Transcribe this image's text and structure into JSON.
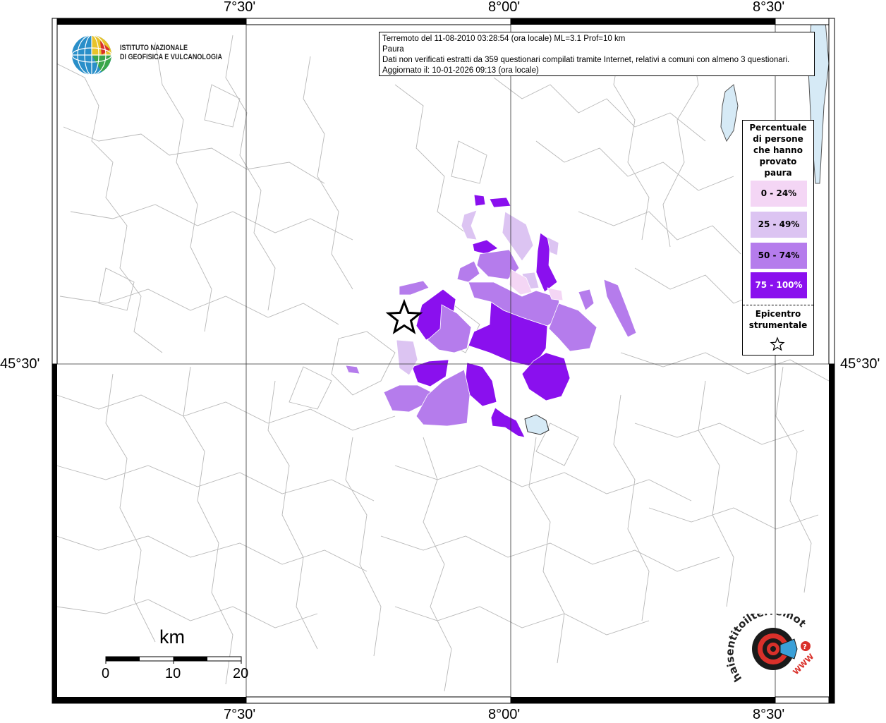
{
  "map": {
    "grid_labels": {
      "lon": [
        "7°30'",
        "8°00'",
        "8°30'"
      ],
      "lat": [
        "45°30'"
      ]
    },
    "colors": {
      "class_0_24": "#f4d6f5",
      "class_25_49": "#dcc4f2",
      "class_50_74": "#b57cec",
      "class_75_100": "#8a10ee",
      "lake": "#d6eaf6",
      "boundaries": "#b8b8b8"
    }
  },
  "info": {
    "line1": "Terremoto del 11-08-2010 03:28:54 (ora locale) ML=3.1 Prof=10 km",
    "line2": "Paura",
    "line3": "Dati non verificati estratti da 359 questionari compilati tramite Internet, relativi a comuni con almeno 3 questionari.",
    "line4": "Aggiornato il: 10-01-2026 09:13 (ora locale)"
  },
  "logo_ingv": {
    "line1": "ISTITUTO NAZIONALE",
    "line2": "DI GEOFISICA E VULCANOLOGIA"
  },
  "legend": {
    "title": [
      "Percentuale",
      "di persone",
      "che hanno",
      "provato",
      "paura"
    ],
    "items": [
      {
        "label": "0 - 24%",
        "color": "#f4d6f5"
      },
      {
        "label": "25 - 49%",
        "color": "#dcc4f2"
      },
      {
        "label": "50 - 74%",
        "color": "#b57cec"
      },
      {
        "label": "75 - 100%",
        "color": "#8a10ee"
      }
    ],
    "epicenter": [
      "Epicentro",
      "strumentale"
    ]
  },
  "scale_bar": {
    "unit": "km",
    "labels": [
      "0",
      "10",
      "20"
    ]
  },
  "logo_hsit": {
    "text": "haisentitoilterremoto.it",
    "www": "WWW"
  }
}
